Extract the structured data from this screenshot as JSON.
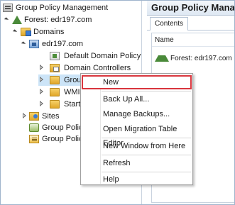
{
  "tree": {
    "root": {
      "label": "Group Policy Management",
      "icon": "gpm-icon"
    },
    "forest": {
      "label": "Forest: edr197.com",
      "icon": "forest-icon"
    },
    "domains": {
      "label": "Domains",
      "icon": "domains-folder-icon"
    },
    "domain": {
      "label": "edr197.com",
      "icon": "domain-icon"
    },
    "children": [
      {
        "label": "Default Domain Policy",
        "icon": "gpo-link-icon"
      },
      {
        "label": "Domain Controllers",
        "icon": "ou-icon"
      },
      {
        "label": "Group Policy Objects",
        "icon": "folder-icon"
      },
      {
        "label": "WMI Filters",
        "icon": "folder-icon"
      },
      {
        "label": "Starter GPOs",
        "icon": "folder-icon"
      }
    ],
    "sites": {
      "label": "Sites",
      "icon": "sites-icon"
    },
    "modeling": {
      "label": "Group Policy Modeling",
      "icon": "modeling-icon"
    },
    "results": {
      "label": "Group Policy Results",
      "icon": "results-icon"
    }
  },
  "right_pane": {
    "title": "Group Policy Manag",
    "tab": "Contents",
    "column_header": "Name",
    "rows": [
      {
        "label": "Forest: edr197.com",
        "icon": "forest-icon"
      }
    ]
  },
  "context_menu": {
    "items": [
      {
        "label": "New",
        "highlighted": true
      },
      {
        "label": "Back Up All..."
      },
      {
        "label": "Manage Backups..."
      },
      {
        "label": "Open Migration Table Editor"
      },
      {
        "label": "New Window from Here"
      },
      {
        "label": "Refresh"
      },
      {
        "label": "Help"
      }
    ]
  },
  "colors": {
    "highlight_outline": "#d9363e",
    "title_gradient": "#dfe8f3"
  }
}
